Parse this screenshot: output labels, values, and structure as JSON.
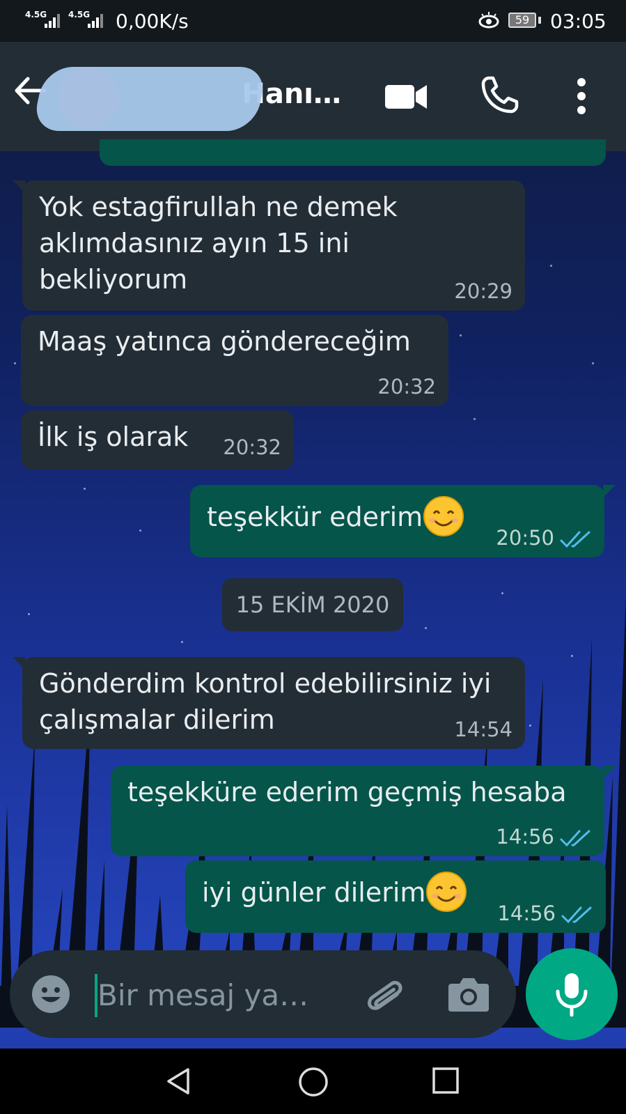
{
  "status_bar": {
    "network1": "4.5G",
    "network2": "4.5G",
    "speed": "0,00K/s",
    "battery": "59",
    "time": "03:05"
  },
  "header": {
    "contact_name": "Hanı…",
    "icons": [
      "back-arrow-icon",
      "avatar",
      "video-call-icon",
      "phone-icon",
      "more-vert-icon"
    ]
  },
  "messages": [
    {
      "direction": "in",
      "text": "Yok estagfirullah ne demek\naklımdasınız ayın 15 ini\nbekliyorum",
      "time": "20:29"
    },
    {
      "direction": "in",
      "text": "Maaş yatınca göndereceğim",
      "time": "20:32"
    },
    {
      "direction": "in",
      "text": "İlk iş olarak",
      "time": "20:32"
    },
    {
      "direction": "out",
      "text": "teşekkür ederim",
      "emoji": "smiling-face-icon",
      "time": "20:50",
      "status": "read"
    },
    {
      "direction": "in",
      "text": "Gönderdim kontrol edebilirsiniz iyi\nçalışmalar dilerim",
      "time": "14:54"
    },
    {
      "direction": "out",
      "text": "teşekküre ederim geçmiş hesaba",
      "time": "14:56",
      "status": "read"
    },
    {
      "direction": "out",
      "text": "iyi günler dilerim",
      "emoji": "smiling-face-icon",
      "time": "14:56",
      "status": "read"
    }
  ],
  "date_divider": "15 EKİM 2020",
  "composer": {
    "placeholder": "Bir mesaj ya…"
  },
  "colors": {
    "accent": "#00a884",
    "incoming_bubble": "#232d36",
    "outgoing_bubble": "#05554a",
    "read_ticks": "#53bdeb"
  }
}
